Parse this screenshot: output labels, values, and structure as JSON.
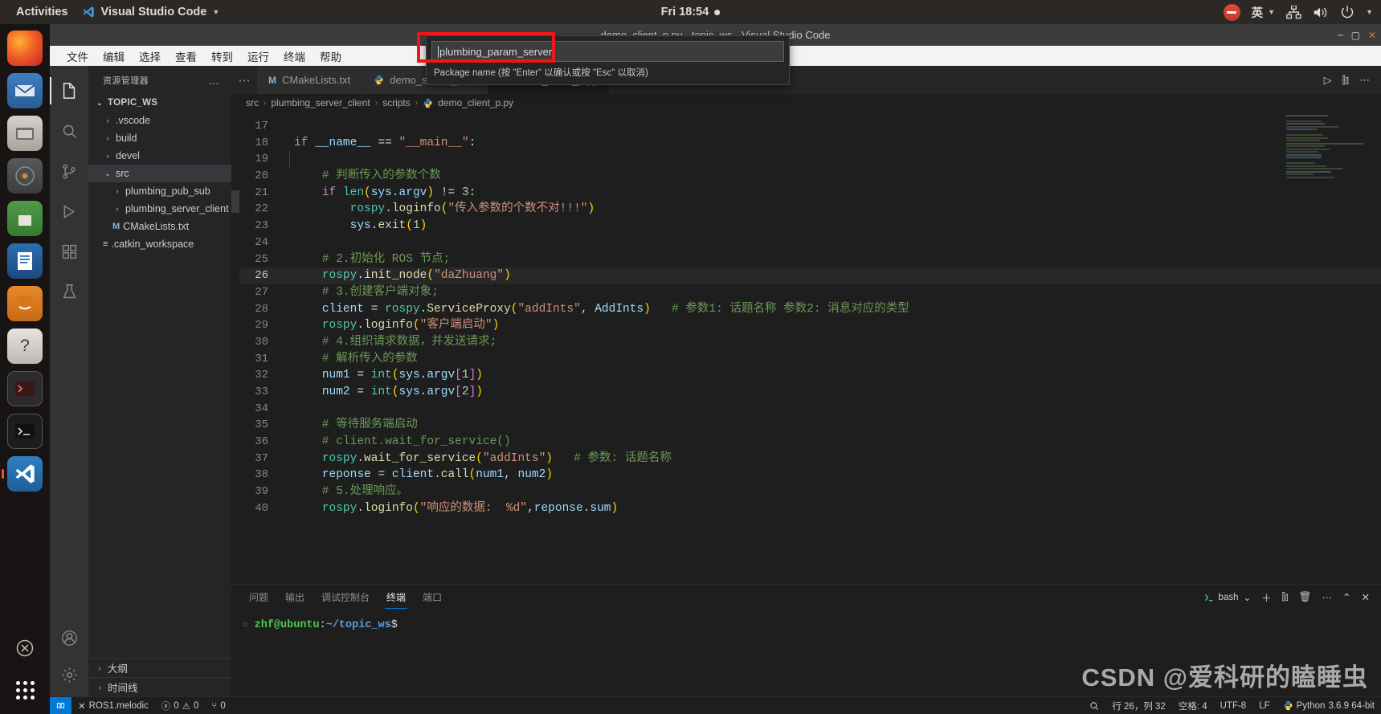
{
  "desktop": {
    "activities": "Activities",
    "app_name": "Visual Studio Code",
    "clock": "Fri 18:54",
    "ime": "英"
  },
  "window": {
    "title": "demo_client_p.py - topic_ws - Visual Studio Code"
  },
  "menu": [
    "文件",
    "编辑",
    "选择",
    "查看",
    "转到",
    "运行",
    "终端",
    "帮助"
  ],
  "sidebar": {
    "header": "资源管理器",
    "more": "…",
    "root": "TOPIC_WS",
    "items": [
      {
        "label": ".vscode",
        "type": "folder",
        "indent": 1,
        "expanded": false
      },
      {
        "label": "build",
        "type": "folder",
        "indent": 1,
        "expanded": false
      },
      {
        "label": "devel",
        "type": "folder",
        "indent": 1,
        "expanded": false
      },
      {
        "label": "src",
        "type": "folder",
        "indent": 1,
        "expanded": true,
        "selected": true
      },
      {
        "label": "plumbing_pub_sub",
        "type": "folder",
        "indent": 2,
        "expanded": false
      },
      {
        "label": "plumbing_server_client",
        "type": "folder",
        "indent": 2,
        "expanded": false
      },
      {
        "label": "CMakeLists.txt",
        "type": "file-m",
        "indent": 2
      },
      {
        "label": ".catkin_workspace",
        "type": "file-eq",
        "indent": 1
      }
    ],
    "footer": [
      "大纲",
      "时间线"
    ]
  },
  "tabs": [
    {
      "label": "CMakeLists.txt",
      "icon": "m-icon",
      "active": false
    },
    {
      "label": "demo_server_p.py",
      "icon": "python-icon",
      "active": false
    },
    {
      "label": "demo_client_p.py",
      "icon": "python-icon",
      "active": true
    }
  ],
  "breadcrumb": [
    "src",
    "plumbing_server_client",
    "scripts",
    "demo_client_p.py"
  ],
  "quick_input": {
    "value": "plumbing_param_server",
    "hint": "Package name (按 \"Enter\" 以确认或按 \"Esc\" 以取消)"
  },
  "editor": {
    "current_line": 26,
    "lines": [
      {
        "n": 17,
        "text": ""
      },
      {
        "n": 18,
        "text": "if __name__ == \"__main__\":"
      },
      {
        "n": 19,
        "text": ""
      },
      {
        "n": 20,
        "text": "    # 判断传入的参数个数"
      },
      {
        "n": 21,
        "text": "    if len(sys.argv) != 3:"
      },
      {
        "n": 22,
        "text": "        rospy.loginfo(\"传入参数的个数不对!!!\")"
      },
      {
        "n": 23,
        "text": "        sys.exit(1)"
      },
      {
        "n": 24,
        "text": ""
      },
      {
        "n": 25,
        "text": "    # 2.初始化 ROS 节点;"
      },
      {
        "n": 26,
        "text": "    rospy.init_node(\"daZhuang\")"
      },
      {
        "n": 27,
        "text": "    # 3.创建客户端对象;"
      },
      {
        "n": 28,
        "text": "    client = rospy.ServiceProxy(\"addInts\", AddInts)   # 参数1: 话题名称 参数2: 消息对应的类型"
      },
      {
        "n": 29,
        "text": "    rospy.loginfo(\"客户端启动\")"
      },
      {
        "n": 30,
        "text": "    # 4.组织请求数据，并发送请求;"
      },
      {
        "n": 31,
        "text": "    # 解析传入的参数"
      },
      {
        "n": 32,
        "text": "    num1 = int(sys.argv[1])"
      },
      {
        "n": 33,
        "text": "    num2 = int(sys.argv[2])"
      },
      {
        "n": 34,
        "text": ""
      },
      {
        "n": 35,
        "text": "    # 等待服务端启动"
      },
      {
        "n": 36,
        "text": "    # client.wait_for_service()"
      },
      {
        "n": 37,
        "text": "    rospy.wait_for_service(\"addInts\")   # 参数: 话题名称"
      },
      {
        "n": 38,
        "text": "    reponse = client.call(num1, num2)"
      },
      {
        "n": 39,
        "text": "    # 5.处理响应。"
      },
      {
        "n": 40,
        "text": "    rospy.loginfo(\"响应的数据:  %d\",reponse.sum)"
      }
    ]
  },
  "panel": {
    "tabs": [
      "问题",
      "输出",
      "调试控制台",
      "终端",
      "端口"
    ],
    "active_tab": "终端",
    "shell_label": "bash",
    "terminal_prompt_user": "zhf@ubuntu",
    "terminal_prompt_colon": ":",
    "terminal_prompt_path": "~/topic_ws",
    "terminal_prompt_dollar": "$"
  },
  "status_bar": {
    "remote": "ROS1.melodic",
    "errors": "0",
    "warnings": "0",
    "ports": "0",
    "cursor": "行 26，列 32",
    "spaces": "空格: 4",
    "encoding": "UTF-8",
    "eol": "LF",
    "language": "Python",
    "version": "3.6.9 64-bit"
  },
  "watermark": "CSDN @爱科研的瞌睡虫"
}
